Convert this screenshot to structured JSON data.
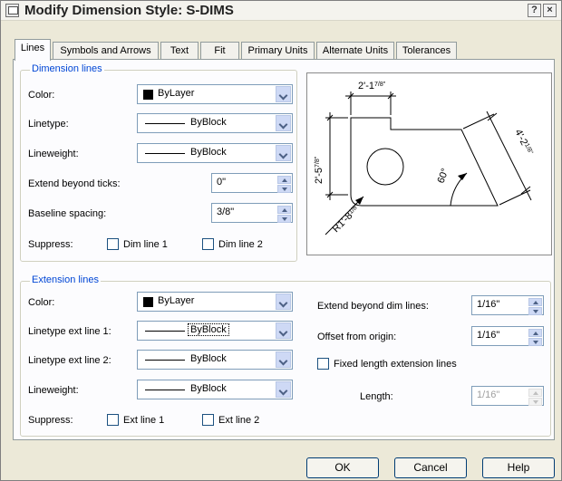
{
  "window": {
    "title": "Modify Dimension Style: S-DIMS",
    "help_button": "?",
    "close_button": "×"
  },
  "tabs": [
    "Lines",
    "Symbols and Arrows",
    "Text",
    "Fit",
    "Primary Units",
    "Alternate Units",
    "Tolerances"
  ],
  "active_tab": "Lines",
  "dimension_lines": {
    "group_label": "Dimension lines",
    "color_label": "Color:",
    "color_value": "ByLayer",
    "linetype_label": "Linetype:",
    "linetype_value": "ByBlock",
    "lineweight_label": "Lineweight:",
    "lineweight_value": "ByBlock",
    "extend_label": "Extend beyond ticks:",
    "extend_value": "0\"",
    "baseline_label": "Baseline spacing:",
    "baseline_value": "3/8\"",
    "suppress_label": "Suppress:",
    "dim_line1": "Dim line 1",
    "dim_line2": "Dim line 2"
  },
  "extension_lines": {
    "group_label": "Extension lines",
    "color_label": "Color:",
    "color_value": "ByLayer",
    "linetype1_label": "Linetype ext line 1:",
    "linetype1_value": "ByBlock",
    "linetype2_label": "Linetype ext line 2:",
    "linetype2_value": "ByBlock",
    "lineweight_label": "Lineweight:",
    "lineweight_value": "ByBlock",
    "suppress_label": "Suppress:",
    "ext_line1": "Ext line 1",
    "ext_line2": "Ext line 2",
    "extend_beyond_label": "Extend beyond dim lines:",
    "extend_beyond_value": "1/16\"",
    "offset_label": "Offset from origin:",
    "offset_value": "1/16\"",
    "fixed_length_label": "Fixed length extension lines",
    "length_label": "Length:",
    "length_value": "1/16\""
  },
  "preview": {
    "dim_top": "2'-1",
    "dim_top_frac": "7/8\"",
    "dim_left": "2'-5",
    "dim_left_frac": "7/8\"",
    "dim_right": "4'-2",
    "dim_right_frac": "1/8\"",
    "dim_angle": "60°",
    "dim_radius": "R1'-8",
    "dim_radius_frac": "1/8\""
  },
  "buttons": {
    "ok": "OK",
    "cancel": "Cancel",
    "help": "Help"
  },
  "colors": {
    "group_label": "#0046d5",
    "dialog_bg": "#ece9d8",
    "panel_bg": "#fcfcfe"
  }
}
